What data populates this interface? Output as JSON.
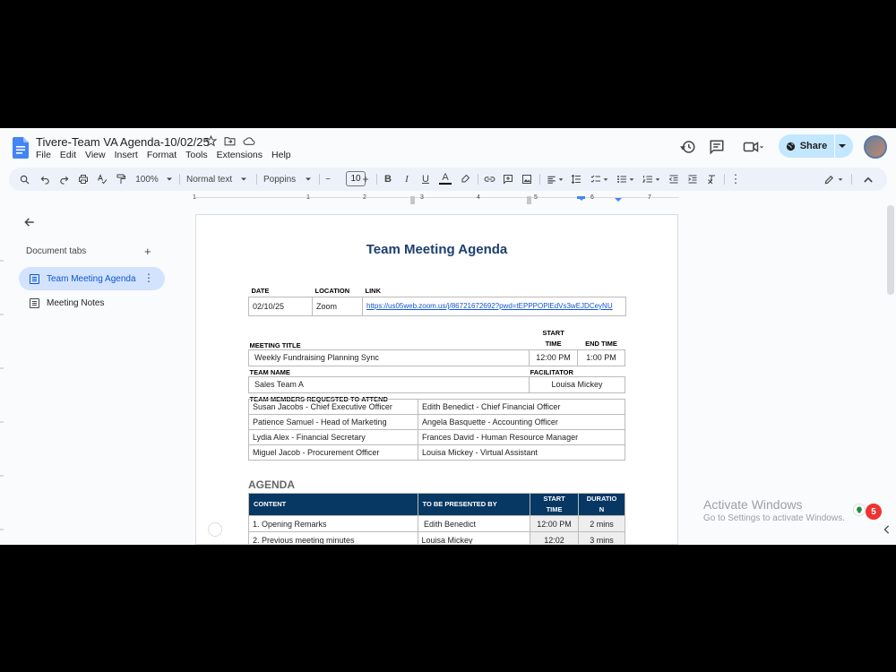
{
  "title": "Tivere-Team VA Agenda-10/02/25",
  "menu": [
    "File",
    "Edit",
    "View",
    "Insert",
    "Format",
    "Tools",
    "Extensions",
    "Help"
  ],
  "share_label": "Share",
  "toolbar": {
    "zoom": "100%",
    "style": "Normal text",
    "font": "Poppins",
    "font_size": "10",
    "minus": "−",
    "plus": "+"
  },
  "ruler_numbers": [
    "1",
    "1",
    "2",
    "3",
    "4",
    "5",
    "6",
    "7"
  ],
  "sidebar": {
    "tabs_heading": "Document tabs",
    "add": "+",
    "more": "⋮",
    "items": [
      {
        "label": "Team Meeting Agenda",
        "active": true
      },
      {
        "label": "Meeting Notes",
        "active": false
      }
    ]
  },
  "doc": {
    "heading": "Team Meeting Agenda",
    "info": {
      "headers": [
        "DATE",
        "LOCATION",
        "LINK"
      ],
      "date": "02/10/25",
      "location": "Zoom",
      "link": "https://us05web.zoom.us/j/86721672692?pwd=tEPPPOPlEdVs3wEJDCeyNU"
    },
    "meeting": {
      "title_label": "MEETING TITLE",
      "start_label_1": "START",
      "start_label_2": "TIME",
      "end_label": "END TIME",
      "title": "Weekly Fundraising Planning Sync",
      "start": "12:00 PM",
      "end": "1:00 PM",
      "team_label": "TEAM NAME",
      "facilitator_label": "FACILITATOR",
      "team": "Sales Team A",
      "facilitator": "Louisa Mickey",
      "members_label": "TEAM MEMBERS REQUESTED TO ATTEND"
    },
    "members": [
      [
        "Susan Jacobs - Chief Executive Officer",
        "Edith Benedict  - Chief Financial Officer"
      ],
      [
        "Patience Samuel - Head of Marketing",
        "Angela Basquette - Accounting Officer"
      ],
      [
        "Lydia Alex - Financial Secretary",
        "Frances David - Human Resource Manager"
      ],
      [
        "Miguel Jacob - Procurement Officer",
        "Louisa Mickey - Virtual Assistant"
      ]
    ],
    "agenda_heading": "AGENDA",
    "agenda_headers": {
      "content": "CONTENT",
      "presenter": "TO BE PRESENTED BY",
      "start_1": "START",
      "start_2": "TIME",
      "dur_1": "DURATIO",
      "dur_2": "N"
    },
    "agenda_rows": [
      {
        "content": "1. Opening Remarks",
        "presenter": " Edith Benedict",
        "start": "12:00 PM",
        "duration": "2 mins"
      },
      {
        "content": "2. Previous meeting minutes",
        "presenter": "Louisa Mickey",
        "start": "12:02",
        "duration": "3 mins"
      }
    ]
  },
  "watermark": {
    "line1": "Activate Windows",
    "line2": "Go to Settings to activate Windows."
  },
  "badge_count": "5",
  "colors": {
    "accent": "#0b57d0",
    "share_bg": "#c2e7ff",
    "table_header": "#073763",
    "heading": "#1c3f6e"
  }
}
